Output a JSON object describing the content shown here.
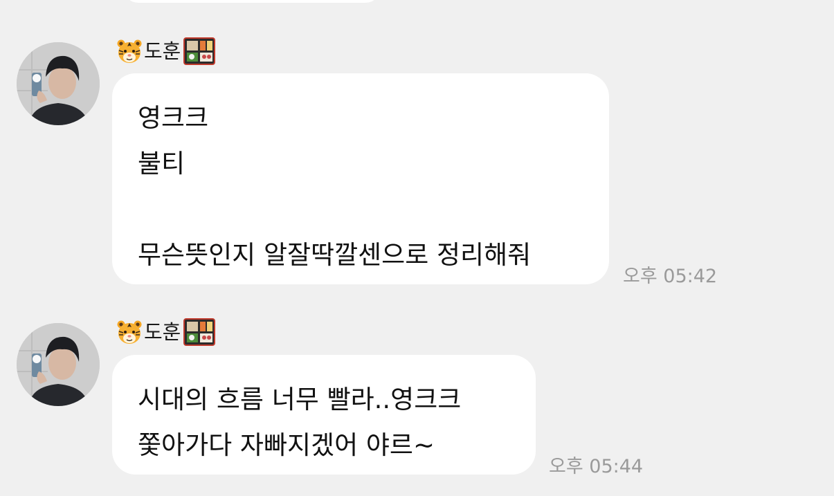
{
  "messages": [
    {
      "sender": "도훈",
      "sender_prefix_icon": "tiger-face-emoji",
      "sender_suffix_icon": "bento-box-emoji",
      "lines": [
        "영크크",
        "불티",
        "",
        "무슨뜻인지 알잘딱깔센으로 정리해줘"
      ],
      "time": "오후 05:42"
    },
    {
      "sender": "도훈",
      "sender_prefix_icon": "tiger-face-emoji",
      "sender_suffix_icon": "bento-box-emoji",
      "lines": [
        "시대의 흐름 너무 빨라..영크크",
        "쫓아가다 자빠지겠어 야르~"
      ],
      "time": "오후 05:44"
    }
  ],
  "colors": {
    "background": "#f0f0f0",
    "bubble": "#ffffff",
    "text": "#111111",
    "time": "#9a9a9a"
  }
}
